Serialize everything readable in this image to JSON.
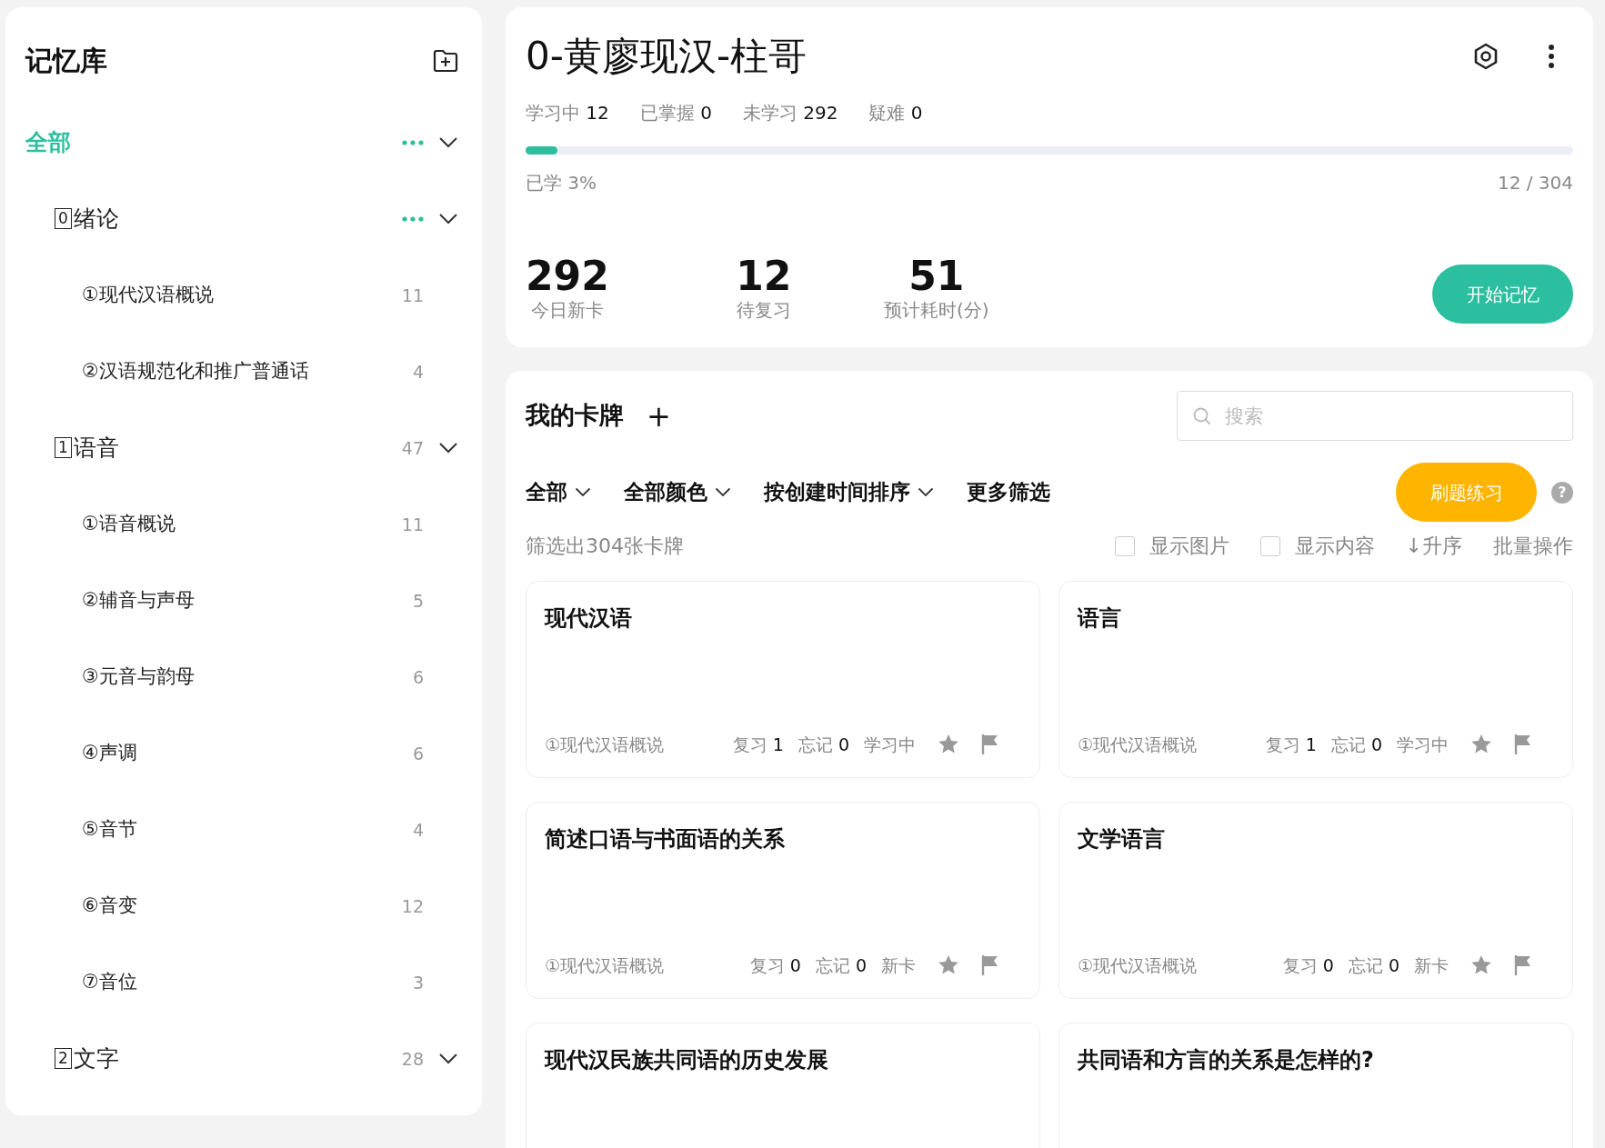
{
  "sidebar": {
    "title": "记忆库",
    "tree": [
      {
        "label": "全部",
        "selected": true,
        "kind": "group",
        "menu": true,
        "children": [
          {
            "number": "0",
            "label": "绪论",
            "selected": false,
            "kind": "group",
            "menu": true,
            "children": [
              {
                "label": "①现代汉语概说",
                "count": "11",
                "selected": false,
                "kind": "leaf"
              },
              {
                "label": "②汉语规范化和推广普通话",
                "count": "4",
                "selected": false,
                "kind": "leaf"
              }
            ]
          },
          {
            "number": "1",
            "label": "语音",
            "count": "47",
            "selected": false,
            "kind": "group",
            "children": [
              {
                "label": "①语音概说",
                "count": "11",
                "selected": false,
                "kind": "leaf"
              },
              {
                "label": "②辅音与声母",
                "count": "5",
                "selected": false,
                "kind": "leaf"
              },
              {
                "label": "③元音与韵母",
                "count": "6",
                "selected": false,
                "kind": "leaf"
              },
              {
                "label": "④声调",
                "count": "6",
                "selected": false,
                "kind": "leaf"
              },
              {
                "label": "⑤音节",
                "count": "4",
                "selected": false,
                "kind": "leaf"
              },
              {
                "label": "⑥音变",
                "count": "12",
                "selected": false,
                "kind": "leaf"
              },
              {
                "label": "⑦音位",
                "count": "3",
                "selected": false,
                "kind": "leaf"
              }
            ]
          },
          {
            "number": "2",
            "label": "文字",
            "count": "28",
            "selected": false,
            "kind": "group"
          }
        ]
      }
    ]
  },
  "deck": {
    "title": "0-黄廖现汉-柱哥",
    "stats": [
      {
        "label": "学习中",
        "value": "12"
      },
      {
        "label": "已掌握",
        "value": "0"
      },
      {
        "label": "未学习",
        "value": "292"
      },
      {
        "label": "疑难",
        "value": "0"
      }
    ],
    "progress": {
      "level": 0.03,
      "caption": "已学 3%",
      "reading": "12 / 304"
    },
    "figures": [
      {
        "value": "292",
        "label": "今日新卡"
      },
      {
        "value": "12",
        "label": "待复习"
      },
      {
        "value": "51",
        "label": "预计耗时(分)"
      }
    ],
    "start_button": "开始记忆"
  },
  "cards_panel": {
    "title": "我的卡牌",
    "add": "+",
    "search": {
      "placeholder": "搜索"
    },
    "filters": [
      {
        "label": "全部",
        "dropdown": true
      },
      {
        "label": "全部颜色",
        "dropdown": true
      },
      {
        "label": "按创建时间排序",
        "dropdown": true
      },
      {
        "label": "更多筛选",
        "dropdown": false
      }
    ],
    "practice_button": "刷题练习",
    "help": "?",
    "count_text": "筛选出304张卡牌",
    "options": [
      {
        "label": "显示图片",
        "checked": false
      },
      {
        "label": "显示内容",
        "checked": false
      }
    ],
    "sort": "↓升序",
    "batch": "批量操作",
    "cards": [
      {
        "title": "现代汉语",
        "deck": "①现代汉语概说",
        "review_label": "复习",
        "review": "1",
        "forget_label": "忘记",
        "forget": "0",
        "status": "学习中"
      },
      {
        "title": "语言",
        "deck": "①现代汉语概说",
        "review_label": "复习",
        "review": "1",
        "forget_label": "忘记",
        "forget": "0",
        "status": "学习中"
      },
      {
        "title": "简述口语与书面语的关系",
        "deck": "①现代汉语概说",
        "review_label": "复习",
        "review": "0",
        "forget_label": "忘记",
        "forget": "0",
        "status": "新卡"
      },
      {
        "title": "文学语言",
        "deck": "①现代汉语概说",
        "review_label": "复习",
        "review": "0",
        "forget_label": "忘记",
        "forget": "0",
        "status": "新卡"
      },
      {
        "title": "现代汉民族共同语的历史发展"
      },
      {
        "title": "共同语和方言的关系是怎样的?"
      }
    ]
  }
}
